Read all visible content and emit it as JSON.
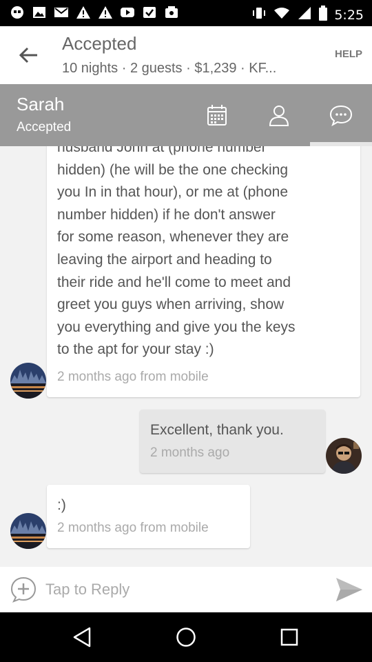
{
  "status_bar": {
    "left_icons": [
      "quote-icon",
      "image-icon",
      "gmail-icon",
      "warning-icon",
      "warning-icon",
      "youtube-icon",
      "check-icon",
      "photos-icon"
    ],
    "time": "5:25"
  },
  "app_bar": {
    "title": "Accepted",
    "subtitle": "10 nights · 2 guests · $1,239 · KF...",
    "help_label": "HELP"
  },
  "host_bar": {
    "name": "Sarah",
    "status": "Accepted",
    "tabs": [
      "calendar-icon",
      "profile-icon",
      "message-icon"
    ],
    "active_tab": "message-icon",
    "background": "#999999"
  },
  "messages": [
    {
      "side": "left",
      "lines": [
        "husband John at (phone number",
        "hidden) (he will be the one checking",
        "you In in that hour), or me at (phone",
        "number hidden) if he don't answer",
        "for some reason, whenever they are",
        "leaving the airport and heading to",
        "their ride and he'll come to meet and",
        "greet you guys when arriving, show",
        "you everything and give you the keys",
        "to the apt for your stay :)"
      ],
      "meta": "2 months ago from mobile"
    },
    {
      "side": "right",
      "text": "Excellent, thank you.",
      "meta": "2 months ago"
    },
    {
      "side": "left",
      "text": ":)",
      "meta": "2 months ago from mobile"
    }
  ],
  "reply": {
    "placeholder": "Tap to Reply"
  },
  "nav_bar": {
    "buttons": [
      "back-icon",
      "home-icon",
      "recents-icon"
    ]
  },
  "colors": {
    "appbar_bg": "#ffffff",
    "hostbar_bg": "#999999",
    "chat_bg": "#f2f2f2",
    "sent_bubble": "#e6e6e6",
    "received_bubble": "#ffffff"
  }
}
